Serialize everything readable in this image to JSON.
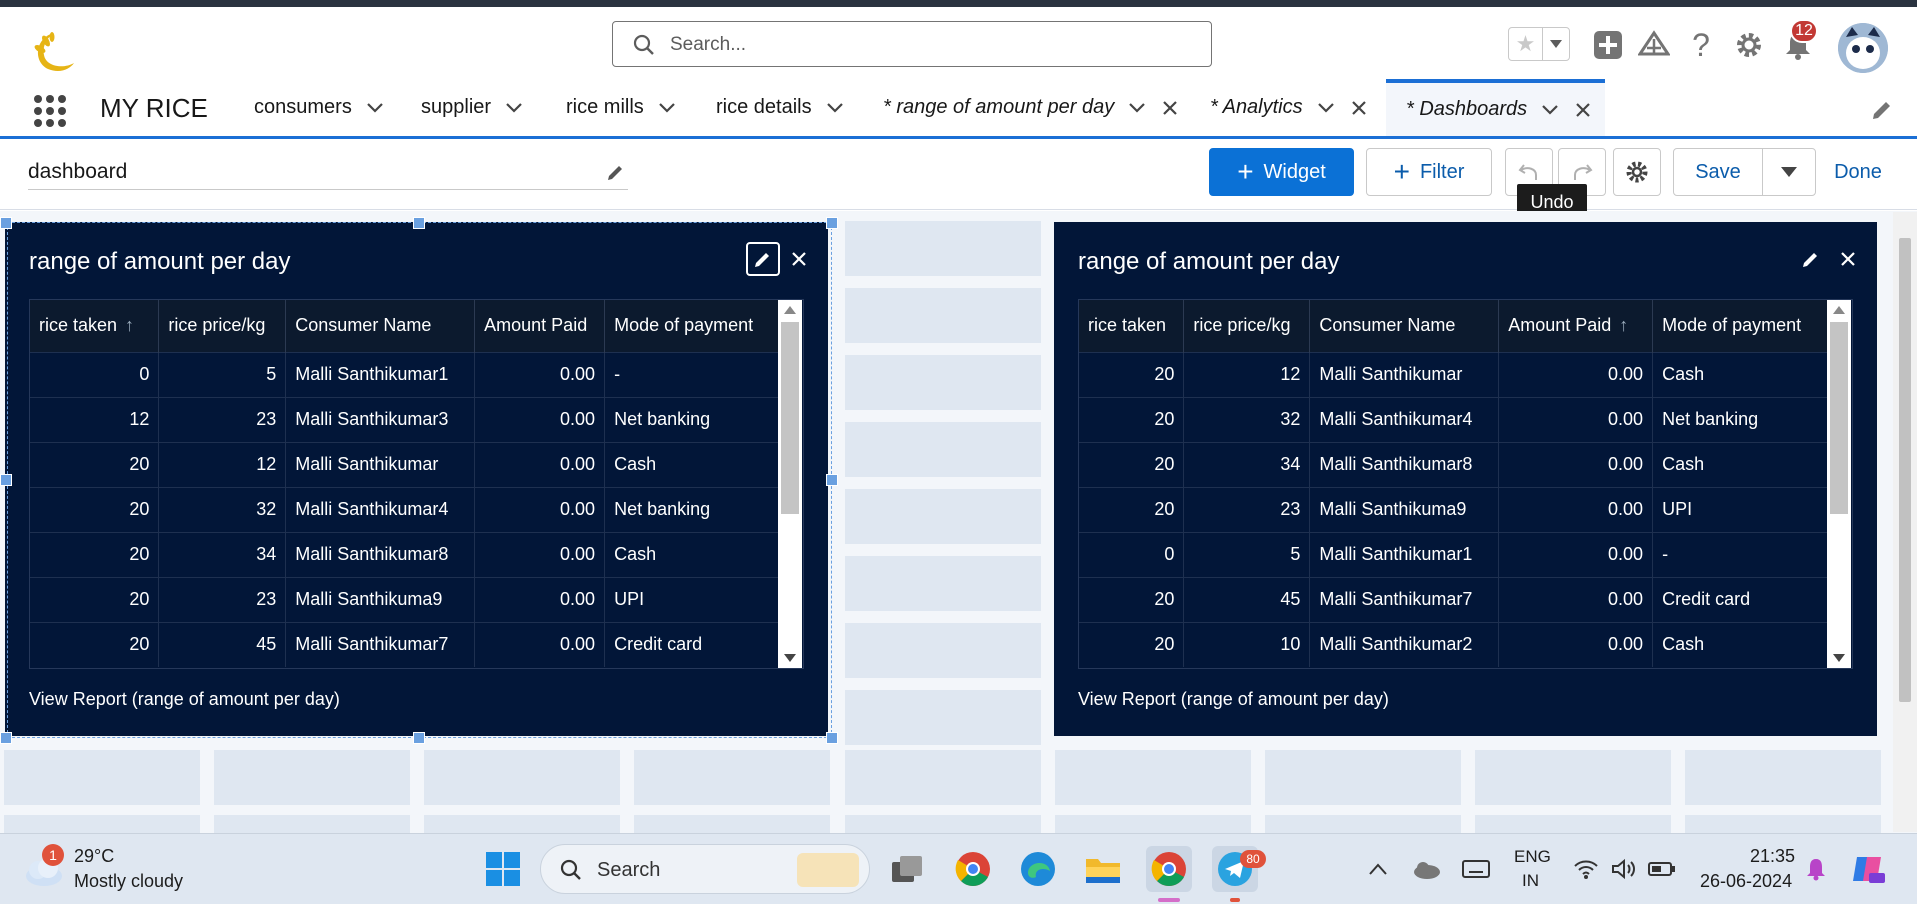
{
  "app": {
    "name": "MY RICE"
  },
  "search": {
    "placeholder": "Search..."
  },
  "notifications": {
    "count": "12"
  },
  "nav": {
    "items": [
      {
        "label": "consumers"
      },
      {
        "label": "supplier"
      },
      {
        "label": "rice mills"
      },
      {
        "label": "rice details"
      }
    ],
    "tabs": [
      {
        "label": "* range of amount per day"
      },
      {
        "label": "* Analytics"
      },
      {
        "label": "* Dashboards"
      }
    ]
  },
  "dashboard": {
    "name": "dashboard"
  },
  "toolbar": {
    "widget_label": "Widget",
    "filter_label": "Filter",
    "save_label": "Save",
    "done_label": "Done",
    "undo_tooltip": "Undo"
  },
  "widgets": [
    {
      "title": "range of amount per day",
      "columns": [
        "rice taken",
        "rice price/kg",
        "Consumer Name",
        "Amount Paid",
        "Mode of payment"
      ],
      "sorted_column": "rice taken",
      "rows": [
        [
          "0",
          "5",
          "Malli Santhikumar1",
          "0.00",
          "-"
        ],
        [
          "12",
          "23",
          "Malli Santhikumar3",
          "0.00",
          "Net banking"
        ],
        [
          "20",
          "12",
          "Malli Santhikumar",
          "0.00",
          "Cash"
        ],
        [
          "20",
          "32",
          "Malli Santhikumar4",
          "0.00",
          "Net banking"
        ],
        [
          "20",
          "34",
          "Malli Santhikumar8",
          "0.00",
          "Cash"
        ],
        [
          "20",
          "23",
          "Malli Santhikuma9",
          "0.00",
          "UPI"
        ],
        [
          "20",
          "45",
          "Malli Santhikumar7",
          "0.00",
          "Credit card"
        ]
      ],
      "link": "View Report (range of amount per day)"
    },
    {
      "title": "range of amount per day",
      "columns": [
        "rice taken",
        "rice price/kg",
        "Consumer Name",
        "Amount Paid",
        "Mode of payment"
      ],
      "sorted_column": "Amount Paid",
      "rows": [
        [
          "20",
          "12",
          "Malli Santhikumar",
          "0.00",
          "Cash"
        ],
        [
          "20",
          "32",
          "Malli Santhikumar4",
          "0.00",
          "Net banking"
        ],
        [
          "20",
          "34",
          "Malli Santhikumar8",
          "0.00",
          "Cash"
        ],
        [
          "20",
          "23",
          "Malli Santhikuma9",
          "0.00",
          "UPI"
        ],
        [
          "0",
          "5",
          "Malli Santhikumar1",
          "0.00",
          "-"
        ],
        [
          "20",
          "45",
          "Malli Santhikumar7",
          "0.00",
          "Credit card"
        ],
        [
          "20",
          "10",
          "Malli Santhikumar2",
          "0.00",
          "Cash"
        ]
      ],
      "link": "View Report (range of amount per day)"
    }
  ],
  "taskbar": {
    "weather_badge": "1",
    "temperature": "29°C",
    "weather": "Mostly cloudy",
    "search_label": "Search",
    "telegram_badge": "80",
    "lang_line1": "ENG",
    "lang_line2": "IN",
    "time": "21:35",
    "date": "26-06-2024"
  },
  "colors": {
    "brand_blue": "#0b71d6",
    "widget_bg": "#021638",
    "canvas_bg": "#f3f6fa"
  }
}
